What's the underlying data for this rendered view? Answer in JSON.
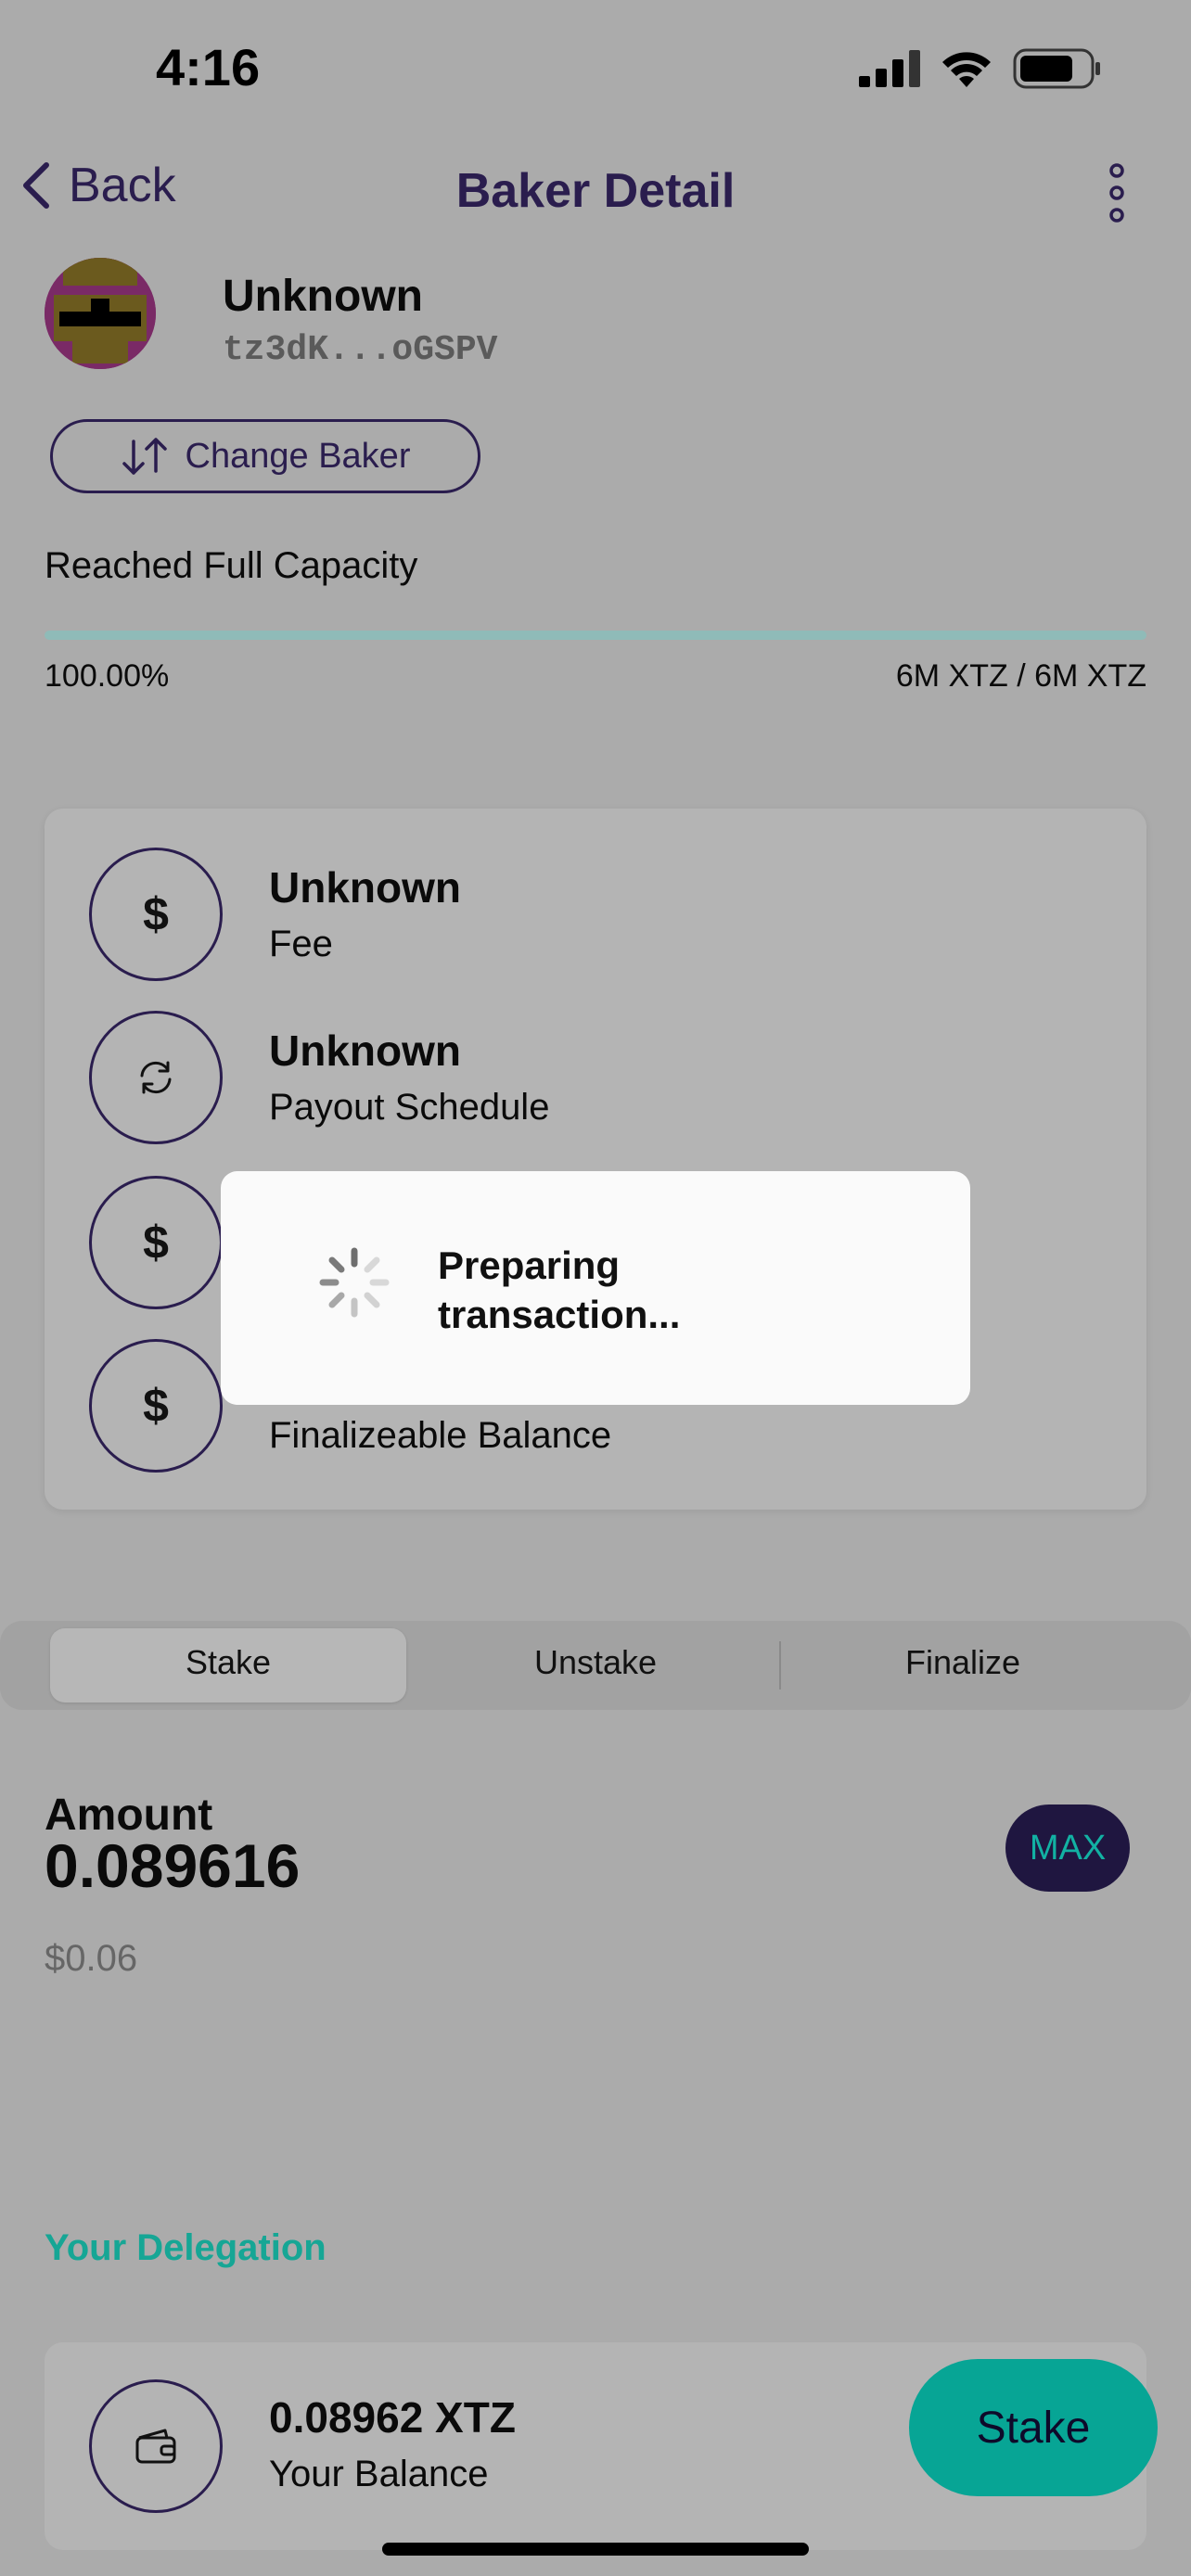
{
  "status_bar": {
    "time": "4:16"
  },
  "nav": {
    "back_label": "Back",
    "title": "Baker Detail"
  },
  "baker": {
    "name": "Unknown",
    "address": "tz3dK...oGSPV",
    "change_label": "Change Baker"
  },
  "capacity": {
    "label": "Reached Full Capacity",
    "percent": "100.00%",
    "amount": "6M XTZ / 6M XTZ",
    "fill_fraction": 1.0
  },
  "info_rows": [
    {
      "title": "Unknown",
      "subtitle": "Fee",
      "icon": "dollar-icon"
    },
    {
      "title": "Unknown",
      "subtitle": "Payout Schedule",
      "icon": "sync-icon"
    },
    {
      "title": "",
      "subtitle": "",
      "icon": "dollar-icon"
    },
    {
      "title": "",
      "subtitle": "Finalizeable Balance",
      "icon": "dollar-icon"
    }
  ],
  "modal": {
    "text": "Preparing transaction..."
  },
  "tabs": {
    "stake": "Stake",
    "unstake": "Unstake",
    "finalize": "Finalize",
    "active": "Stake"
  },
  "amount": {
    "label": "Amount",
    "value": "0.089616",
    "usd": "$0.06",
    "max_label": "MAX"
  },
  "delegation": {
    "heading": "Your Delegation",
    "balance": "0.08962 XTZ",
    "balance_label": "Your Balance",
    "stake_label": "Stake"
  },
  "colors": {
    "accent_purple": "#2a1d4e",
    "accent_teal": "#07a595"
  }
}
